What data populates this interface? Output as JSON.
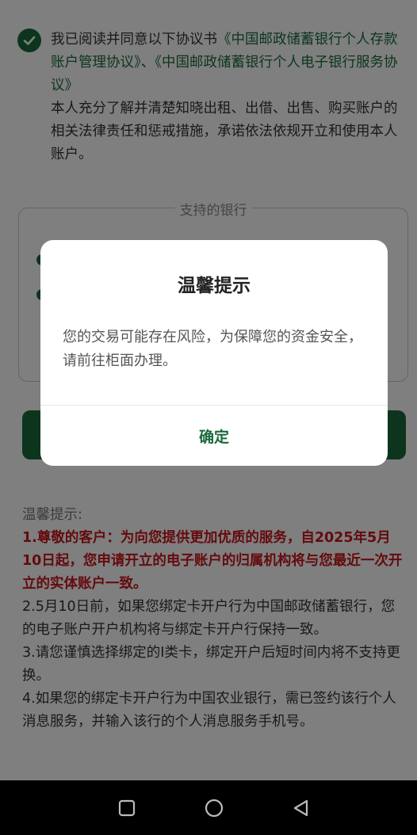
{
  "agreement": {
    "prefix": "我已阅读并同意以下协议书",
    "link1": "《中国邮政储蓄银行个人存款账户管理协议》",
    "sep": "、",
    "link2": "《中国邮政储蓄银行个人电子银行服务协议》",
    "statement": "本人充分了解并清楚知晓出租、出借、出售、购买账户的相关法律责任和惩戒措施，承诺依法依规开立和使用本人账户。"
  },
  "banks": {
    "title": "支持的银行"
  },
  "tips": {
    "heading": "温馨提示:",
    "item1": "1.尊敬的客户：为向您提供更加优质的服务，自2025年5月10日起，您申请开立的电子账户的归属机构将与您最近一次开立的实体账户一致。",
    "item2": "2.5月10日前，如果您绑定卡开户行为中国邮政储蓄银行，您的电子账户开户机构将与绑定卡开户行保持一致。",
    "item3": "3.请您谨慎选择绑定的Ⅰ类卡，绑定开户后短时间内将不支持更换。",
    "item4": "4.如果您的绑定卡开户行为中国农业银行，需已签约该行个人消息服务，并输入该行的个人消息服务手机号。"
  },
  "dialog": {
    "title": "温馨提示",
    "message": "您的交易可能存在风险，为保障您的资金安全，请前往柜面办理。",
    "confirm": "确定"
  },
  "colors": {
    "primary": "#1a6b3c",
    "alert": "#c8161d"
  },
  "icons": {
    "check": "check-circle-icon",
    "recent": "square-icon",
    "home": "circle-icon",
    "back": "triangle-back-icon"
  }
}
